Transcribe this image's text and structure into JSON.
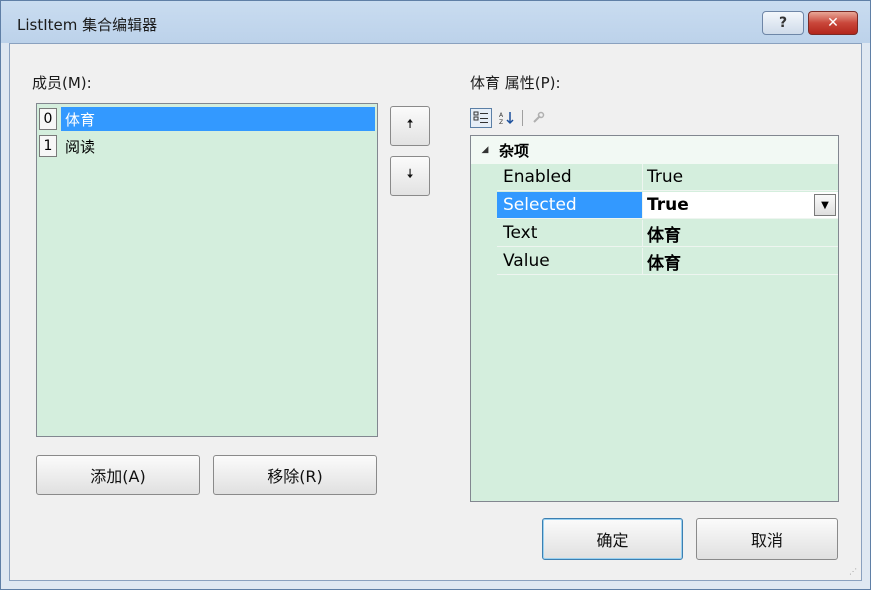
{
  "window": {
    "title": "ListItem 集合编辑器",
    "help_glyph": "?",
    "close_glyph": "✕"
  },
  "members": {
    "label": "成员(M):",
    "items": [
      {
        "index": "0",
        "text": "体育",
        "selected": true
      },
      {
        "index": "1",
        "text": "阅读",
        "selected": false
      }
    ],
    "move_up_glyph": "🠅",
    "move_down_glyph": "🠇"
  },
  "buttons": {
    "add": "添加(A)",
    "remove": "移除(R)",
    "ok": "确定",
    "cancel": "取消"
  },
  "properties": {
    "label": "体育 属性(P):",
    "toolbar": {
      "categorized_icon": "categorized-icon",
      "alphabetical_icon": "alphabetical-icon",
      "property_pages_icon": "wrench-icon"
    },
    "category": "杂项",
    "rows": [
      {
        "name": "Enabled",
        "value": "True"
      },
      {
        "name": "Selected",
        "value": "True"
      },
      {
        "name": "Text",
        "value": "体育"
      },
      {
        "name": "Value",
        "value": "体育"
      }
    ]
  }
}
